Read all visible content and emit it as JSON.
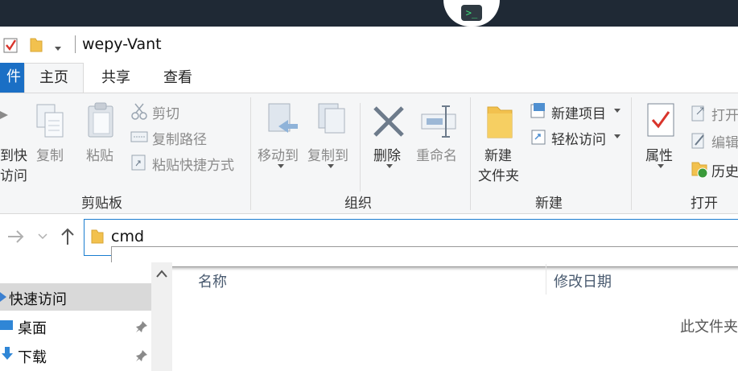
{
  "window": {
    "title": "wepy-Vant"
  },
  "tabs": [
    {
      "label": "件"
    },
    {
      "label": "主页"
    },
    {
      "label": "共享"
    },
    {
      "label": "查看"
    }
  ],
  "ribbon": {
    "clipboard": {
      "pin_top": "到快",
      "pin_bottom": "访问",
      "copy": "复制",
      "paste": "粘贴",
      "cut": "剪切",
      "copy_path": "复制路径",
      "paste_shortcut": "粘贴快捷方式",
      "group": "剪贴板"
    },
    "organize": {
      "move_to": "移动到",
      "copy_to": "复制到",
      "delete": "删除",
      "rename": "重命名",
      "group": "组织"
    },
    "new": {
      "new_folder_top": "新建",
      "new_folder_bottom": "文件夹",
      "new_item": "新建项目",
      "easy_access": "轻松访问",
      "group": "新建"
    },
    "open": {
      "properties": "属性",
      "open": "打开",
      "edit": "编辑",
      "history": "历史",
      "group": "打开"
    }
  },
  "address": {
    "value": "cmd"
  },
  "nav": {
    "quick_access": "快速访问",
    "desktop": "桌面",
    "downloads": "下载"
  },
  "content": {
    "col_name": "名称",
    "col_modified": "修改日期",
    "empty_text": "此文件夹"
  },
  "colors": {
    "accent": "#1a6fc5",
    "folder": "#f2c14e",
    "terminal": "#3ee07a"
  }
}
